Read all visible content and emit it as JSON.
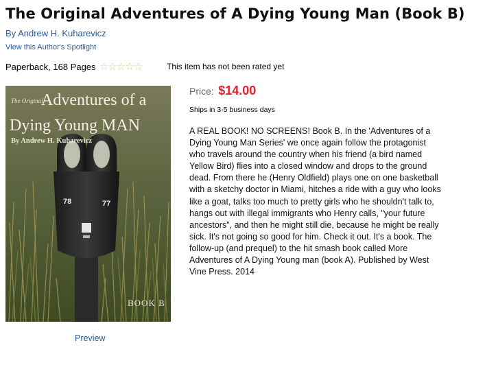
{
  "product": {
    "title": "The Original Adventures of A Dying Young Man (Book B)",
    "author_link": "By Andrew H. Kuharevicz",
    "spotlight_link": "View this Author's Spotlight",
    "format": "Paperback, 168 Pages",
    "rating": {
      "value": 0,
      "max": 5,
      "note": "This item has not been rated yet"
    },
    "price_label": "Price:",
    "price": "$14.00",
    "shipping": "Ships in 3-5 business days",
    "description": "A REAL BOOK! NO SCREENS! Book B. In the 'Adventures of a Dying Young Man Series' we once again follow the protagonist who travels around the country when his friend (a bird named Yellow Bird) flies into a closed window and drops to the ground dead. From there he (Henry Oldfield) plays one on one basketball with a sketchy doctor in Miami, hitches a ride with a guy who looks like a goat, talks too much to pretty girls who he shouldn't talk to, hangs out with illegal immigrants who Henry calls, \"your future ancestors\", and then he might still die, because he might be really sick. It's not going so good for him. Check it out. It's a book. The follow-up (and prequel) to the hit smash book called More Adventures of A Dying Young man (book A). Published by West Vine Press. 2014",
    "preview_link": "Preview"
  },
  "cover": {
    "small_text": "The Original",
    "title_line1": "Adventures of a",
    "title_line2": "Dying Young MAN",
    "byline": "By Andrew H. Kuharevicz",
    "meter_left_number": "78",
    "meter_right_number": "77",
    "label": "BOOK B"
  },
  "colors": {
    "link": "#2a5a96",
    "price": "#e0232b",
    "star_outline": "#e9c78a"
  },
  "icons": {
    "rating_star": "star-outline-icon"
  }
}
